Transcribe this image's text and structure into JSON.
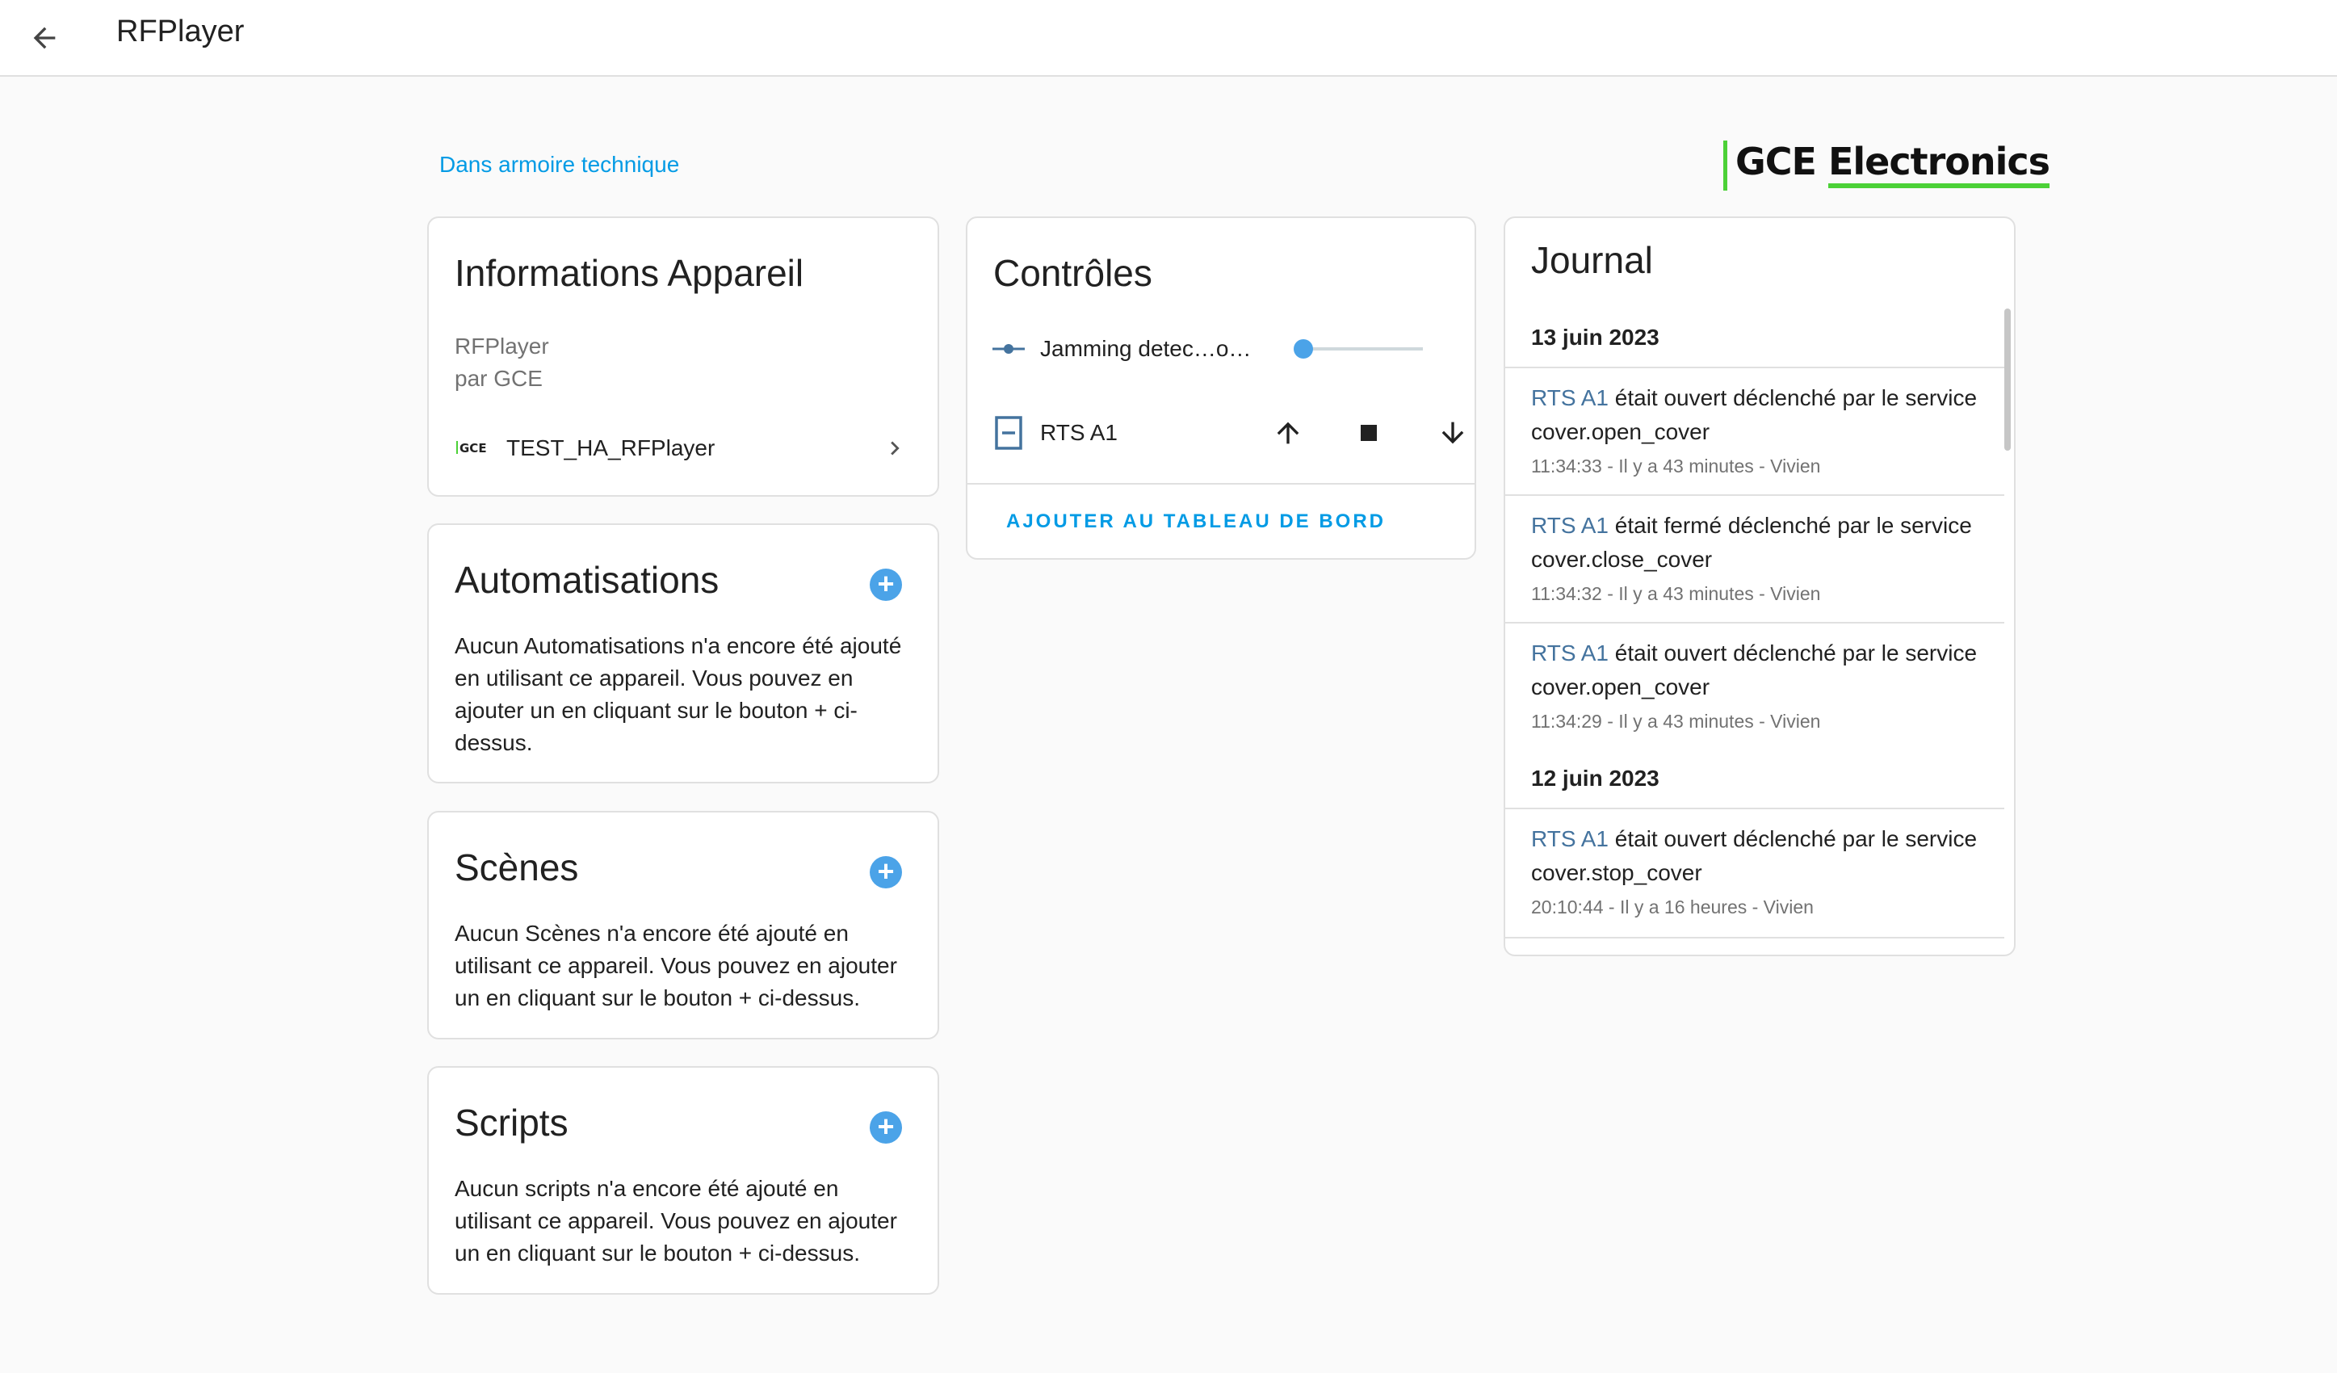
{
  "header": {
    "title": "RFPlayer"
  },
  "area": {
    "link": "Dans armoire technique"
  },
  "brand": {
    "gce": "GCE",
    "electronics": "Electronics",
    "accent_color": "#4cd137"
  },
  "info": {
    "title": "Informations Appareil",
    "model": "RFPlayer",
    "manufacturer": "par GCE",
    "device_logo": "GCE",
    "device_name": "TEST_HA_RFPlayer"
  },
  "automations": {
    "title": "Automatisations",
    "text": "Aucun Automatisations n'a encore été ajouté en utilisant ce appareil. Vous pouvez en ajouter un en cliquant sur le bouton + ci-dessus."
  },
  "scenes": {
    "title": "Scènes",
    "text": "Aucun Scènes n'a encore été ajouté en utilisant ce appareil. Vous pouvez en ajouter un en cliquant sur le bouton + ci-dessus."
  },
  "scripts": {
    "title": "Scripts",
    "text": "Aucun scripts n'a encore été ajouté en utilisant ce appareil. Vous pouvez en ajouter un en cliquant sur le bouton + ci-dessus."
  },
  "controls": {
    "title": "Contrôles",
    "jamming_label": "Jamming detec…o…",
    "jamming_value": 0,
    "cover_label": "RTS A1",
    "add_dashboard": "AJOUTER AU TABLEAU DE BORD"
  },
  "journal": {
    "title": "Journal",
    "groups": [
      {
        "date": "13 juin 2023",
        "entries": [
          {
            "entity": "RTS A1",
            "message": " était ouvert déclenché par le service cover.open_cover",
            "meta": "11:34:33 - Il y a 43 minutes - Vivien"
          },
          {
            "entity": "RTS A1",
            "message": " était fermé déclenché par le service cover.close_cover",
            "meta": "11:34:32 - Il y a 43 minutes - Vivien"
          },
          {
            "entity": "RTS A1",
            "message": " était ouvert déclenché par le service cover.open_cover",
            "meta": "11:34:29 - Il y a 43 minutes - Vivien"
          }
        ]
      },
      {
        "date": "12 juin 2023",
        "entries": [
          {
            "entity": "RTS A1",
            "message": " était ouvert déclenché par le service cover.stop_cover",
            "meta": "20:10:44 - Il y a 16 heures - Vivien"
          }
        ]
      }
    ]
  },
  "colors": {
    "primary": "#039be5",
    "accent": "#4ba3e8",
    "entity_link": "#44739e"
  }
}
